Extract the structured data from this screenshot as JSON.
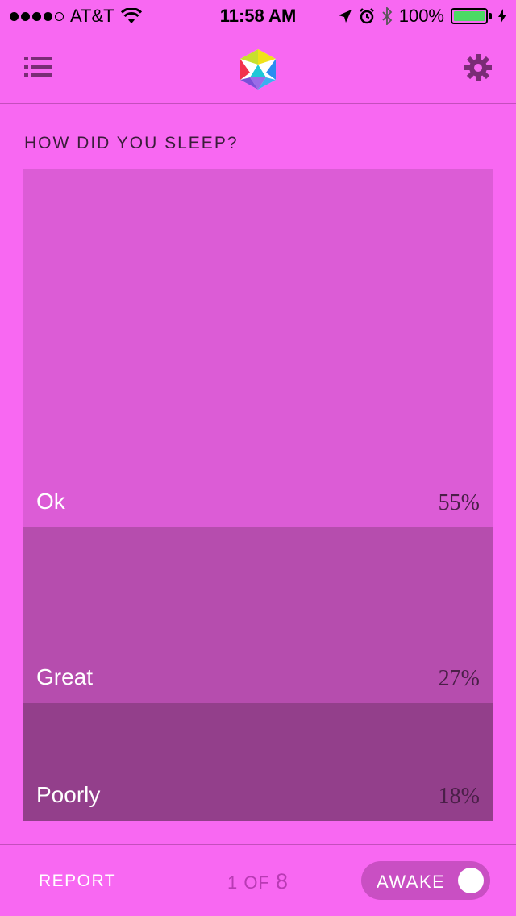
{
  "status_bar": {
    "carrier": "AT&T",
    "time": "11:58 AM",
    "battery": "100%",
    "signal_bars_filled": 4,
    "signal_bars_total": 5
  },
  "nav": {
    "left_icon": "list-icon",
    "center_icon": "logo-icon",
    "right_icon": "gear-icon"
  },
  "question": "HOW DID YOU SLEEP?",
  "chart_data": {
    "type": "bar",
    "categories": [
      "Ok",
      "Great",
      "Poorly"
    ],
    "values": [
      55,
      27,
      18
    ],
    "value_labels": [
      "55%",
      "27%",
      "18%"
    ],
    "colors": [
      "#dc5cd6",
      "#b64dae",
      "#933f8b"
    ],
    "title": "",
    "xlabel": "",
    "ylabel": ""
  },
  "footer": {
    "report_label": "REPORT",
    "pager_prefix": "1 OF",
    "pager_total": "8",
    "toggle_label": "AWAKE",
    "toggle_on": true
  },
  "colors": {
    "background": "#f868f2",
    "toggle": "#c94fc3",
    "battery": "#4cd964"
  }
}
